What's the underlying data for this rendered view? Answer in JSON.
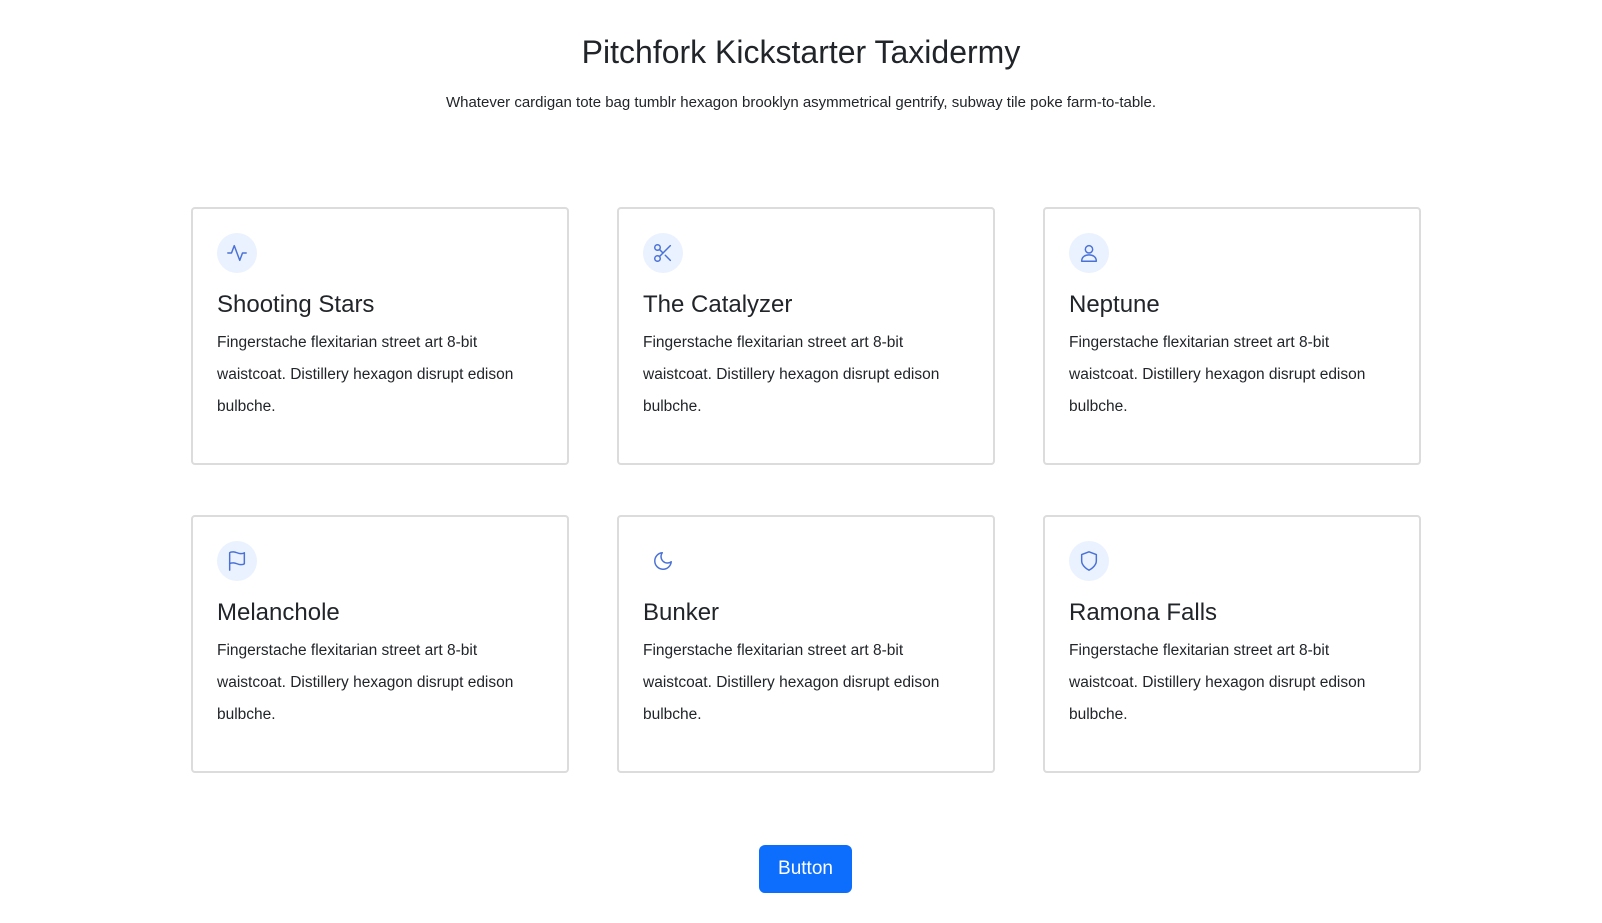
{
  "header": {
    "title": "Pitchfork Kickstarter Taxidermy",
    "subtitle": "Whatever cardigan tote bag tumblr hexagon brooklyn asymmetrical gentrify, subway tile poke farm-to-table."
  },
  "cards": [
    {
      "icon": "pulse-icon",
      "title": "Shooting Stars",
      "text": "Fingerstache flexitarian street art 8-bit waistcoat. Distillery hexagon disrupt edison bulbche."
    },
    {
      "icon": "scissors-icon",
      "title": "The Catalyzer",
      "text": "Fingerstache flexitarian street art 8-bit waistcoat. Distillery hexagon disrupt edison bulbche."
    },
    {
      "icon": "user-icon",
      "title": "Neptune",
      "text": "Fingerstache flexitarian street art 8-bit waistcoat. Distillery hexagon disrupt edison bulbche."
    },
    {
      "icon": "flag-icon",
      "title": "Melanchole",
      "text": "Fingerstache flexitarian street art 8-bit waistcoat. Distillery hexagon disrupt edison bulbche."
    },
    {
      "icon": "moon-icon",
      "title": "Bunker",
      "text": "Fingerstache flexitarian street art 8-bit waistcoat. Distillery hexagon disrupt edison bulbche."
    },
    {
      "icon": "shield-icon",
      "title": "Ramona Falls",
      "text": "Fingerstache flexitarian street art 8-bit waistcoat. Distillery hexagon disrupt edison bulbche."
    }
  ],
  "button": {
    "label": "Button"
  },
  "colors": {
    "accent": "#0d6efd",
    "icon": "#4a72d6",
    "icon_background": "#eaf1ff",
    "card_border": "#dcdcdc"
  }
}
